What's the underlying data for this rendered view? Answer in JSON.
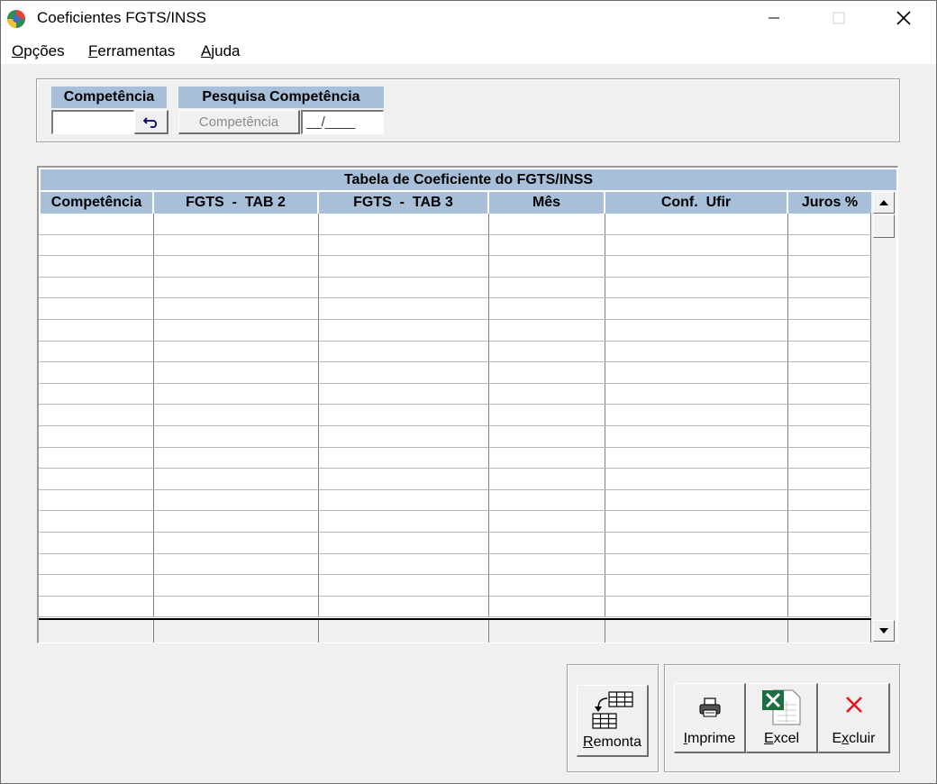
{
  "window": {
    "title": "Coeficientes FGTS/INSS"
  },
  "menu": [
    {
      "first": "O",
      "rest": "pções"
    },
    {
      "first": "F",
      "rest": "erramentas"
    },
    {
      "first": "A",
      "rest": "juda"
    }
  ],
  "filters": {
    "competencia_label": "Competência",
    "competencia_value": "",
    "pesquisa_label": "Pesquisa Competência",
    "pesquisa_button": "Competência",
    "pesquisa_value": "__/____"
  },
  "grid": {
    "title": "Tabela de Coeficiente do FGTS/INSS",
    "columns": [
      "Competência",
      "FGTS  -  TAB 2",
      "FGTS  -  TAB 3",
      "Mês",
      "Conf.  Ufir",
      "Juros %"
    ],
    "rows": []
  },
  "buttons": {
    "remonta": {
      "first": "R",
      "rest": "emonta"
    },
    "imprime": {
      "first": "I",
      "rest": "mprime"
    },
    "excel": {
      "first": "E",
      "rest": "xcel"
    },
    "excluir": {
      "pre": "E",
      "ul": "x",
      "rest": "cluir"
    }
  },
  "colors": {
    "header_blue": "#a7bfd8",
    "close_red": "#e81123"
  }
}
